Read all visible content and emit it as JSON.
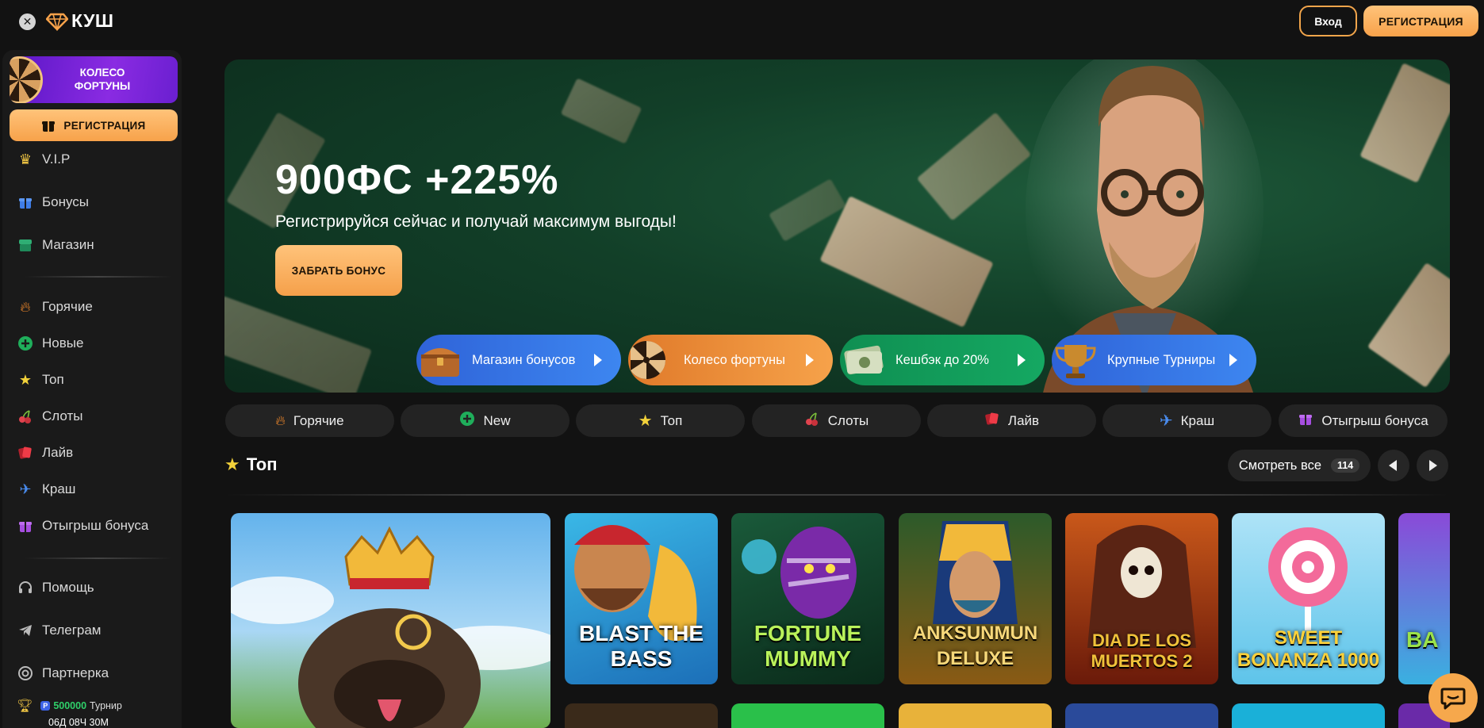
{
  "header": {
    "logo_text": "КУШ",
    "login_label": "Вход",
    "register_label": "РЕГИСТРАЦИЯ"
  },
  "sidebar": {
    "wheel_card": "КОЛЕСО ФОРТУНЫ",
    "register_label": "РЕГИСТРАЦИЯ",
    "items_top": [
      {
        "label": "V.I.P",
        "icon": "crown-icon"
      },
      {
        "label": "Бонусы",
        "icon": "gift-icon"
      },
      {
        "label": "Магазин",
        "icon": "shop-icon"
      }
    ],
    "items_games": [
      {
        "label": "Горячие",
        "icon": "fire-icon"
      },
      {
        "label": "Новые",
        "icon": "plus-circle-icon"
      },
      {
        "label": "Топ",
        "icon": "star-icon"
      },
      {
        "label": "Слоты",
        "icon": "cherry-icon"
      },
      {
        "label": "Лайв",
        "icon": "cards-icon"
      },
      {
        "label": "Краш",
        "icon": "plane-icon"
      },
      {
        "label": "Отыгрыш бонуса",
        "icon": "gift-icon"
      }
    ],
    "items_bottom": [
      {
        "label": "Помощь",
        "icon": "headphones-icon"
      },
      {
        "label": "Телеграм",
        "icon": "telegram-icon"
      },
      {
        "label": "Партнерка",
        "icon": "partner-icon"
      }
    ],
    "tournament": {
      "badge": "P",
      "amount": "500000",
      "label": "Турнир",
      "timer": "06Д 08Ч 30М"
    }
  },
  "hero": {
    "title": "900ФС +225%",
    "subtitle": "Регистрируйся сейчас и получай максимум выгоды!",
    "cta": "ЗАБРАТЬ БОНУС",
    "promos": [
      {
        "label": "Магазин бонусов",
        "icon": "chest-icon"
      },
      {
        "label": "Колесо фортуны",
        "icon": "wheel-icon"
      },
      {
        "label": "Кешбэк до 20%",
        "icon": "money-icon"
      },
      {
        "label": "Крупные Турниры",
        "icon": "trophy-icon"
      }
    ]
  },
  "categories": [
    {
      "label": "Горячие",
      "icon": "fire-icon"
    },
    {
      "label": "New",
      "icon": "plus-circle-icon"
    },
    {
      "label": "Топ",
      "icon": "star-icon"
    },
    {
      "label": "Слоты",
      "icon": "cherry-icon"
    },
    {
      "label": "Лайв",
      "icon": "cards-icon"
    },
    {
      "label": "Краш",
      "icon": "plane-icon"
    },
    {
      "label": "Отыгрыш бонуса",
      "icon": "gift-icon"
    }
  ],
  "section": {
    "title": "Топ",
    "see_all": "Смотреть все",
    "count": "114"
  },
  "games": [
    {
      "name": ""
    },
    {
      "name": "BLAST THE BASS"
    },
    {
      "name": "FORTUNE MUMMY"
    },
    {
      "name": "ANKSUNMUN DELUXE"
    },
    {
      "name": "DIA DE LOS MUERTOS 2"
    },
    {
      "name": "SWEET BONANZA 1000"
    },
    {
      "name": "BA"
    }
  ],
  "colors": {
    "accent": "#f7a24a",
    "background": "#121212",
    "sidebar": "#1a1a1a",
    "pill": "#232323"
  }
}
